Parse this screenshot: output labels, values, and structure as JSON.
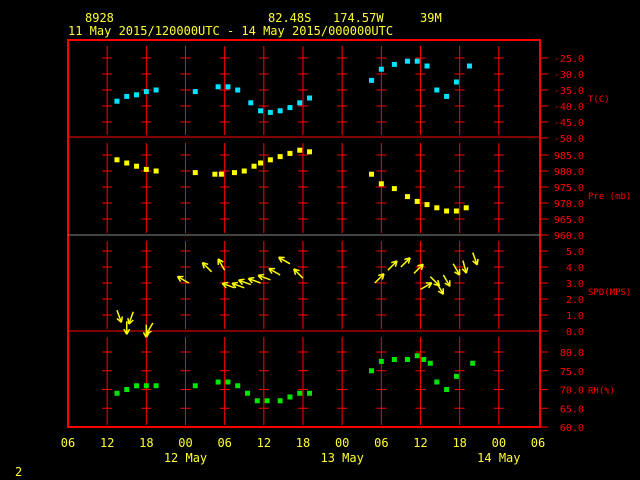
{
  "header": {
    "station_id": "8928",
    "latitude": "82.48S",
    "longitude": "174.57W",
    "elevation": "39M",
    "period": "11 May 2015/120000UTC - 14 May 2015/000000UTC"
  },
  "footer": {
    "page_number": "2"
  },
  "colors": {
    "frame": "#ff0000",
    "text": "#ffff33",
    "temperature": "#00e5ff",
    "pressure": "#ffff00",
    "wind": "#ffff00",
    "rh": "#00e600"
  },
  "chart_data": [
    {
      "type": "scatter",
      "ylabel": "T(C)",
      "ylim": [
        -50,
        -25
      ],
      "yticks": [
        "-25.0",
        "-30.0",
        "-35.0",
        "-40.0",
        "-45.0",
        "-50.0"
      ],
      "color": "#00e5ff",
      "points": [
        [
          "2015-05-11T13:30Z",
          -38.5
        ],
        [
          "2015-05-11T15:00Z",
          -37
        ],
        [
          "2015-05-11T16:30Z",
          -36.5
        ],
        [
          "2015-05-11T18:00Z",
          -35.5
        ],
        [
          "2015-05-11T19:30Z",
          -35
        ],
        [
          "2015-05-12T01:30Z",
          -35.5
        ],
        [
          "2015-05-12T05:00Z",
          -34
        ],
        [
          "2015-05-12T06:30Z",
          -34
        ],
        [
          "2015-05-12T08:00Z",
          -35
        ],
        [
          "2015-05-12T10:00Z",
          -39
        ],
        [
          "2015-05-12T11:30Z",
          -41.5
        ],
        [
          "2015-05-12T13:00Z",
          -42
        ],
        [
          "2015-05-12T14:30Z",
          -41.5
        ],
        [
          "2015-05-12T16:00Z",
          -40.5
        ],
        [
          "2015-05-12T17:30Z",
          -39
        ],
        [
          "2015-05-12T19:00Z",
          -37.5
        ],
        [
          "2015-05-13T04:30Z",
          -32
        ],
        [
          "2015-05-13T06:00Z",
          -28.5
        ],
        [
          "2015-05-13T08:00Z",
          -27
        ],
        [
          "2015-05-13T10:00Z",
          -26
        ],
        [
          "2015-05-13T11:30Z",
          -26
        ],
        [
          "2015-05-13T13:00Z",
          -27.5
        ],
        [
          "2015-05-13T14:30Z",
          -35
        ],
        [
          "2015-05-13T16:00Z",
          -37
        ],
        [
          "2015-05-13T17:30Z",
          -32.5
        ],
        [
          "2015-05-13T19:30Z",
          -27.5
        ]
      ]
    },
    {
      "type": "scatter",
      "ylabel": "Pre (mb)",
      "ylim": [
        960,
        985
      ],
      "yticks": [
        "985.0",
        "980.0",
        "975.0",
        "970.0",
        "965.0",
        "960.0"
      ],
      "color": "#ffff00",
      "points": [
        [
          "2015-05-11T13:30Z",
          983.5
        ],
        [
          "2015-05-11T15:00Z",
          982.5
        ],
        [
          "2015-05-11T16:30Z",
          981.5
        ],
        [
          "2015-05-11T18:00Z",
          980.5
        ],
        [
          "2015-05-11T19:30Z",
          980
        ],
        [
          "2015-05-12T01:30Z",
          979.5
        ],
        [
          "2015-05-12T04:30Z",
          979
        ],
        [
          "2015-05-12T05:30Z",
          979
        ],
        [
          "2015-05-12T07:30Z",
          979.5
        ],
        [
          "2015-05-12T09:00Z",
          980
        ],
        [
          "2015-05-12T10:30Z",
          981.5
        ],
        [
          "2015-05-12T11:30Z",
          982.5
        ],
        [
          "2015-05-12T13:00Z",
          983.5
        ],
        [
          "2015-05-12T14:30Z",
          984.5
        ],
        [
          "2015-05-12T16:00Z",
          985.5
        ],
        [
          "2015-05-12T17:30Z",
          986.5
        ],
        [
          "2015-05-12T19:00Z",
          986
        ],
        [
          "2015-05-13T04:30Z",
          979
        ],
        [
          "2015-05-13T06:00Z",
          976
        ],
        [
          "2015-05-13T08:00Z",
          974.5
        ],
        [
          "2015-05-13T10:00Z",
          972
        ],
        [
          "2015-05-13T11:30Z",
          970.5
        ],
        [
          "2015-05-13T13:00Z",
          969.5
        ],
        [
          "2015-05-13T14:30Z",
          968.5
        ],
        [
          "2015-05-13T16:00Z",
          967.5
        ],
        [
          "2015-05-13T17:30Z",
          967.5
        ],
        [
          "2015-05-13T19:00Z",
          968.5
        ]
      ]
    },
    {
      "type": "vector",
      "ylabel": "SPD(MPS)",
      "ylim": [
        0,
        5
      ],
      "yticks": [
        "5.0",
        "4.0",
        "3.0",
        "2.0",
        "1.0",
        "0.0"
      ],
      "color": "#ffff00",
      "vector_direction_convention": "arrow points toward, compass degrees",
      "points": [
        [
          "2015-05-11T13:30Z",
          1.3,
          160
        ],
        [
          "2015-05-11T15:00Z",
          0.6,
          180
        ],
        [
          "2015-05-11T16:00Z",
          1.2,
          200
        ],
        [
          "2015-05-11T18:00Z",
          0.4,
          180
        ],
        [
          "2015-05-11T19:00Z",
          0.5,
          210
        ],
        [
          "2015-05-12T00:30Z",
          3.0,
          300
        ],
        [
          "2015-05-12T04:00Z",
          3.7,
          315
        ],
        [
          "2015-05-12T06:00Z",
          3.8,
          330
        ],
        [
          "2015-05-12T07:30Z",
          2.7,
          290
        ],
        [
          "2015-05-12T09:00Z",
          2.7,
          290
        ],
        [
          "2015-05-12T10:00Z",
          2.9,
          290
        ],
        [
          "2015-05-12T11:30Z",
          3.0,
          290
        ],
        [
          "2015-05-12T13:00Z",
          3.2,
          290
        ],
        [
          "2015-05-12T14:30Z",
          3.5,
          300
        ],
        [
          "2015-05-12T16:00Z",
          4.2,
          300
        ],
        [
          "2015-05-12T18:00Z",
          3.3,
          315
        ],
        [
          "2015-05-13T05:00Z",
          3.0,
          45
        ],
        [
          "2015-05-13T07:00Z",
          3.8,
          45
        ],
        [
          "2015-05-13T09:00Z",
          4.0,
          45
        ],
        [
          "2015-05-13T11:00Z",
          3.6,
          45
        ],
        [
          "2015-05-13T12:00Z",
          2.6,
          60
        ],
        [
          "2015-05-13T13:30Z",
          3.4,
          135
        ],
        [
          "2015-05-13T14:30Z",
          3.0,
          150
        ],
        [
          "2015-05-13T15:30Z",
          3.5,
          150
        ],
        [
          "2015-05-13T17:00Z",
          4.2,
          150
        ],
        [
          "2015-05-13T18:30Z",
          4.4,
          165
        ],
        [
          "2015-05-13T20:00Z",
          4.9,
          160
        ]
      ]
    },
    {
      "type": "scatter",
      "ylabel": "RH(%)",
      "ylim": [
        60,
        80
      ],
      "yticks": [
        "80.0",
        "75.0",
        "70.0",
        "65.0",
        "60.0"
      ],
      "color": "#00e600",
      "points": [
        [
          "2015-05-11T13:30Z",
          69
        ],
        [
          "2015-05-11T15:00Z",
          70
        ],
        [
          "2015-05-11T16:30Z",
          71
        ],
        [
          "2015-05-11T18:00Z",
          71
        ],
        [
          "2015-05-11T19:30Z",
          71
        ],
        [
          "2015-05-12T01:30Z",
          71
        ],
        [
          "2015-05-12T05:00Z",
          72
        ],
        [
          "2015-05-12T06:30Z",
          72
        ],
        [
          "2015-05-12T08:00Z",
          71
        ],
        [
          "2015-05-12T09:30Z",
          69
        ],
        [
          "2015-05-12T11:00Z",
          67
        ],
        [
          "2015-05-12T12:30Z",
          67
        ],
        [
          "2015-05-12T14:30Z",
          67
        ],
        [
          "2015-05-12T16:00Z",
          68
        ],
        [
          "2015-05-12T17:30Z",
          69
        ],
        [
          "2015-05-12T19:00Z",
          69
        ],
        [
          "2015-05-13T04:30Z",
          75
        ],
        [
          "2015-05-13T06:00Z",
          77.5
        ],
        [
          "2015-05-13T08:00Z",
          78
        ],
        [
          "2015-05-13T10:00Z",
          78
        ],
        [
          "2015-05-13T11:30Z",
          79
        ],
        [
          "2015-05-13T12:30Z",
          78
        ],
        [
          "2015-05-13T13:30Z",
          77
        ],
        [
          "2015-05-13T14:30Z",
          72
        ],
        [
          "2015-05-13T16:00Z",
          70
        ],
        [
          "2015-05-13T17:30Z",
          73.5
        ],
        [
          "2015-05-13T20:00Z",
          77
        ]
      ]
    }
  ],
  "xaxis": {
    "range": [
      "2015-05-11T06:00Z",
      "2015-05-14T06:00Z"
    ],
    "tick_labels": [
      "06",
      "12",
      "18",
      "00",
      "06",
      "12",
      "18",
      "00",
      "06",
      "12",
      "18",
      "00",
      "06"
    ],
    "date_labels": [
      {
        "label": "12 May",
        "tick": 3
      },
      {
        "label": "13 May",
        "tick": 7
      },
      {
        "label": "14 May",
        "tick": 11
      }
    ]
  }
}
